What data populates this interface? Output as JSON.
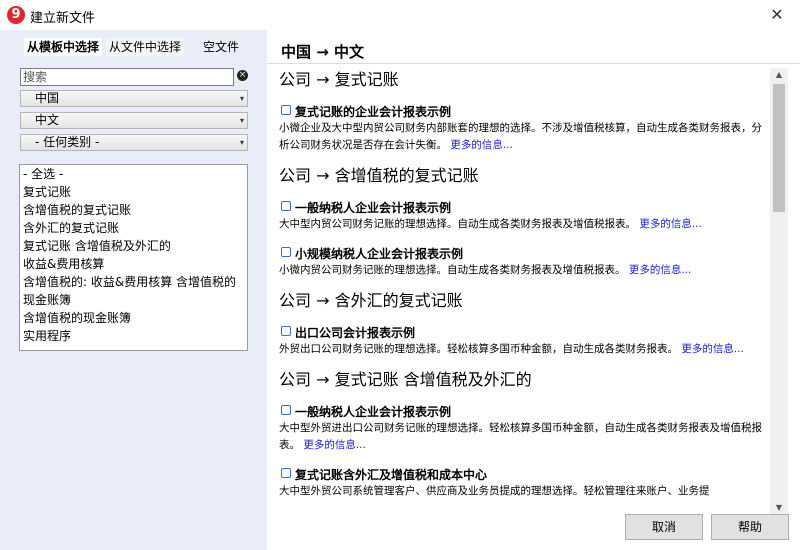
{
  "window": {
    "title": "建立新文件",
    "icon_glyph": "9",
    "close_glyph": "✕"
  },
  "left": {
    "tabs": [
      "从模板中选择",
      "从文件中选择",
      "空文件"
    ],
    "search": {
      "placeholder": "搜索",
      "value": "搜索"
    },
    "clear_glyph": "×",
    "selects": [
      {
        "value": "中国"
      },
      {
        "value": "中文"
      },
      {
        "value": "- 任何类别 -"
      }
    ],
    "dropdown_arrow": "▾",
    "categories": [
      "- 全选 -",
      "复式记账",
      "含增值税的复式记账",
      "含外汇的复式记账",
      "复式记账 含增值税及外汇的",
      "收益&费用核算",
      "含增值税的: 收益&费用核算 含增值税的",
      "现金账簿",
      "含增值税的现金账簿",
      "实用程序"
    ]
  },
  "right": {
    "path": "中国 → 中文",
    "more_label": "更多的信息...",
    "sections": [
      {
        "title": "公司 → 复式记账",
        "entries": [
          {
            "title": "复式记账的企业会计报表示例",
            "desc": "小微企业及大中型内贸公司财务内部账套的理想的选择。不涉及增值税核算，自动生成各类财务报表，分析公司财务状况是否存在会计失衡。"
          }
        ]
      },
      {
        "title": "公司 → 含增值税的复式记账",
        "entries": [
          {
            "title": "一般纳税人企业会计报表示例",
            "desc": "大中型内贸公司财务记账的理想选择。自动生成各类财务报表及增值税报表。"
          },
          {
            "title": "小规模纳税人企业会计报表示例",
            "desc": "小微内贸公司财务记账的理想选择。自动生成各类财务报表及增值税报表。"
          }
        ]
      },
      {
        "title": "公司 → 含外汇的复式记账",
        "entries": [
          {
            "title": "出口公司会计报表示例",
            "desc": "外贸出口公司财务记账的理想选择。轻松核算多国币种金额，自动生成各类财务报表。"
          }
        ]
      },
      {
        "title": "公司 → 复式记账 含增值税及外汇的",
        "entries": [
          {
            "title": "一般纳税人企业会计报表示例",
            "desc": "大中型外贸进出口公司财务记账的理想选择。轻松核算多国币种金额，自动生成各类财务报表及增值税报表。"
          },
          {
            "title": "复式记账含外汇及增值税和成本中心",
            "desc": "大中型外贸公司系统管理客户、供应商及业务员提成的理想选择。轻松管理往来账户、业务提"
          }
        ]
      }
    ],
    "scroll_up": "▲",
    "scroll_down": "▼"
  },
  "footer": {
    "cancel": "取消",
    "help": "帮助"
  }
}
